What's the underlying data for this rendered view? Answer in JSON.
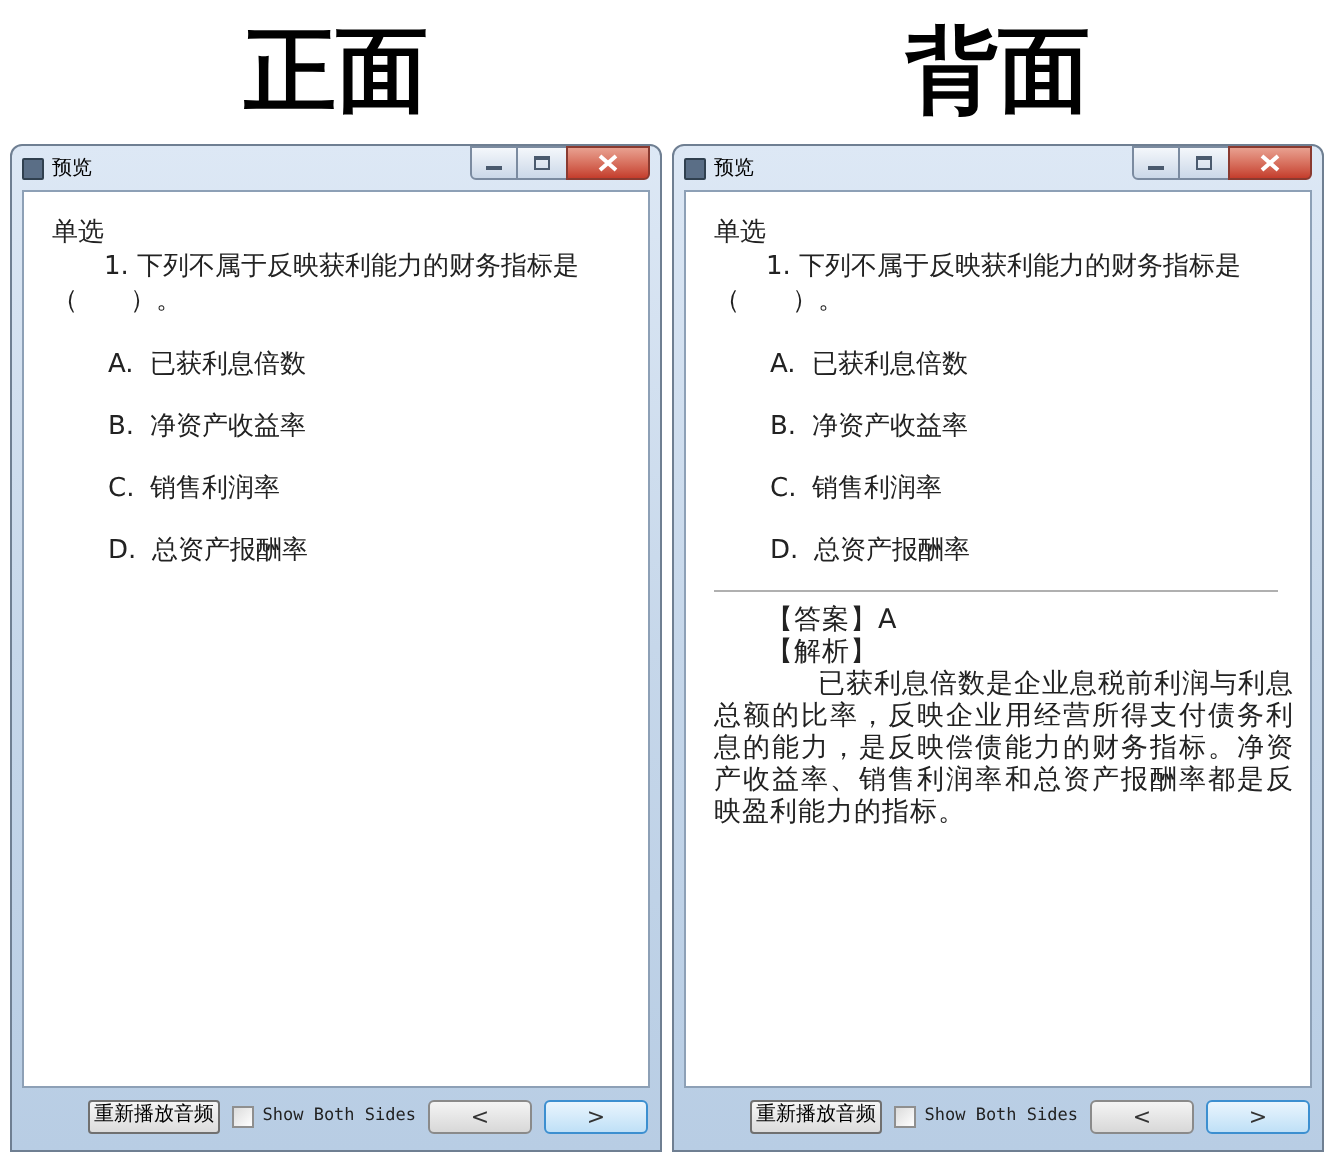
{
  "panels": [
    {
      "heading": "正面",
      "window": {
        "title": "预览",
        "question_type": "单选",
        "question": "1. 下列不属于反映获利能力的财务指标是（　　）。",
        "options": [
          {
            "letter": "A.",
            "text": "已获利息倍数"
          },
          {
            "letter": "B.",
            "text": "净资产收益率"
          },
          {
            "letter": "C.",
            "text": "销售利润率"
          },
          {
            "letter": "D.",
            "text": "总资产报酬率"
          }
        ],
        "footer": {
          "replay_button": "重新播放音频",
          "show_both_sides": {
            "label": "Show Both Sides",
            "checked": false
          },
          "prev_button": "<",
          "next_button": ">"
        }
      }
    },
    {
      "heading": "背面",
      "window": {
        "title": "预览",
        "question_type": "单选",
        "question": "1. 下列不属于反映获利能力的财务指标是（　　）。",
        "options": [
          {
            "letter": "A.",
            "text": "已获利息倍数"
          },
          {
            "letter": "B.",
            "text": "净资产收益率"
          },
          {
            "letter": "C.",
            "text": "销售利润率"
          },
          {
            "letter": "D.",
            "text": "总资产报酬率"
          }
        ],
        "answer": "【答案】A",
        "analysis_label": "【解析】",
        "analysis": "已获利息倍数是企业息税前利润与利息总额的比率，反映企业用经营所得支付债务利息的能力，是反映偿债能力的财务指标。净资产收益率、销售利润率和总资产报酬率都是反映盈利能力的指标。",
        "footer": {
          "replay_button": "重新播放音频",
          "show_both_sides": {
            "label": "Show Both Sides",
            "checked": false
          },
          "prev_button": "<",
          "next_button": ">"
        }
      }
    }
  ]
}
